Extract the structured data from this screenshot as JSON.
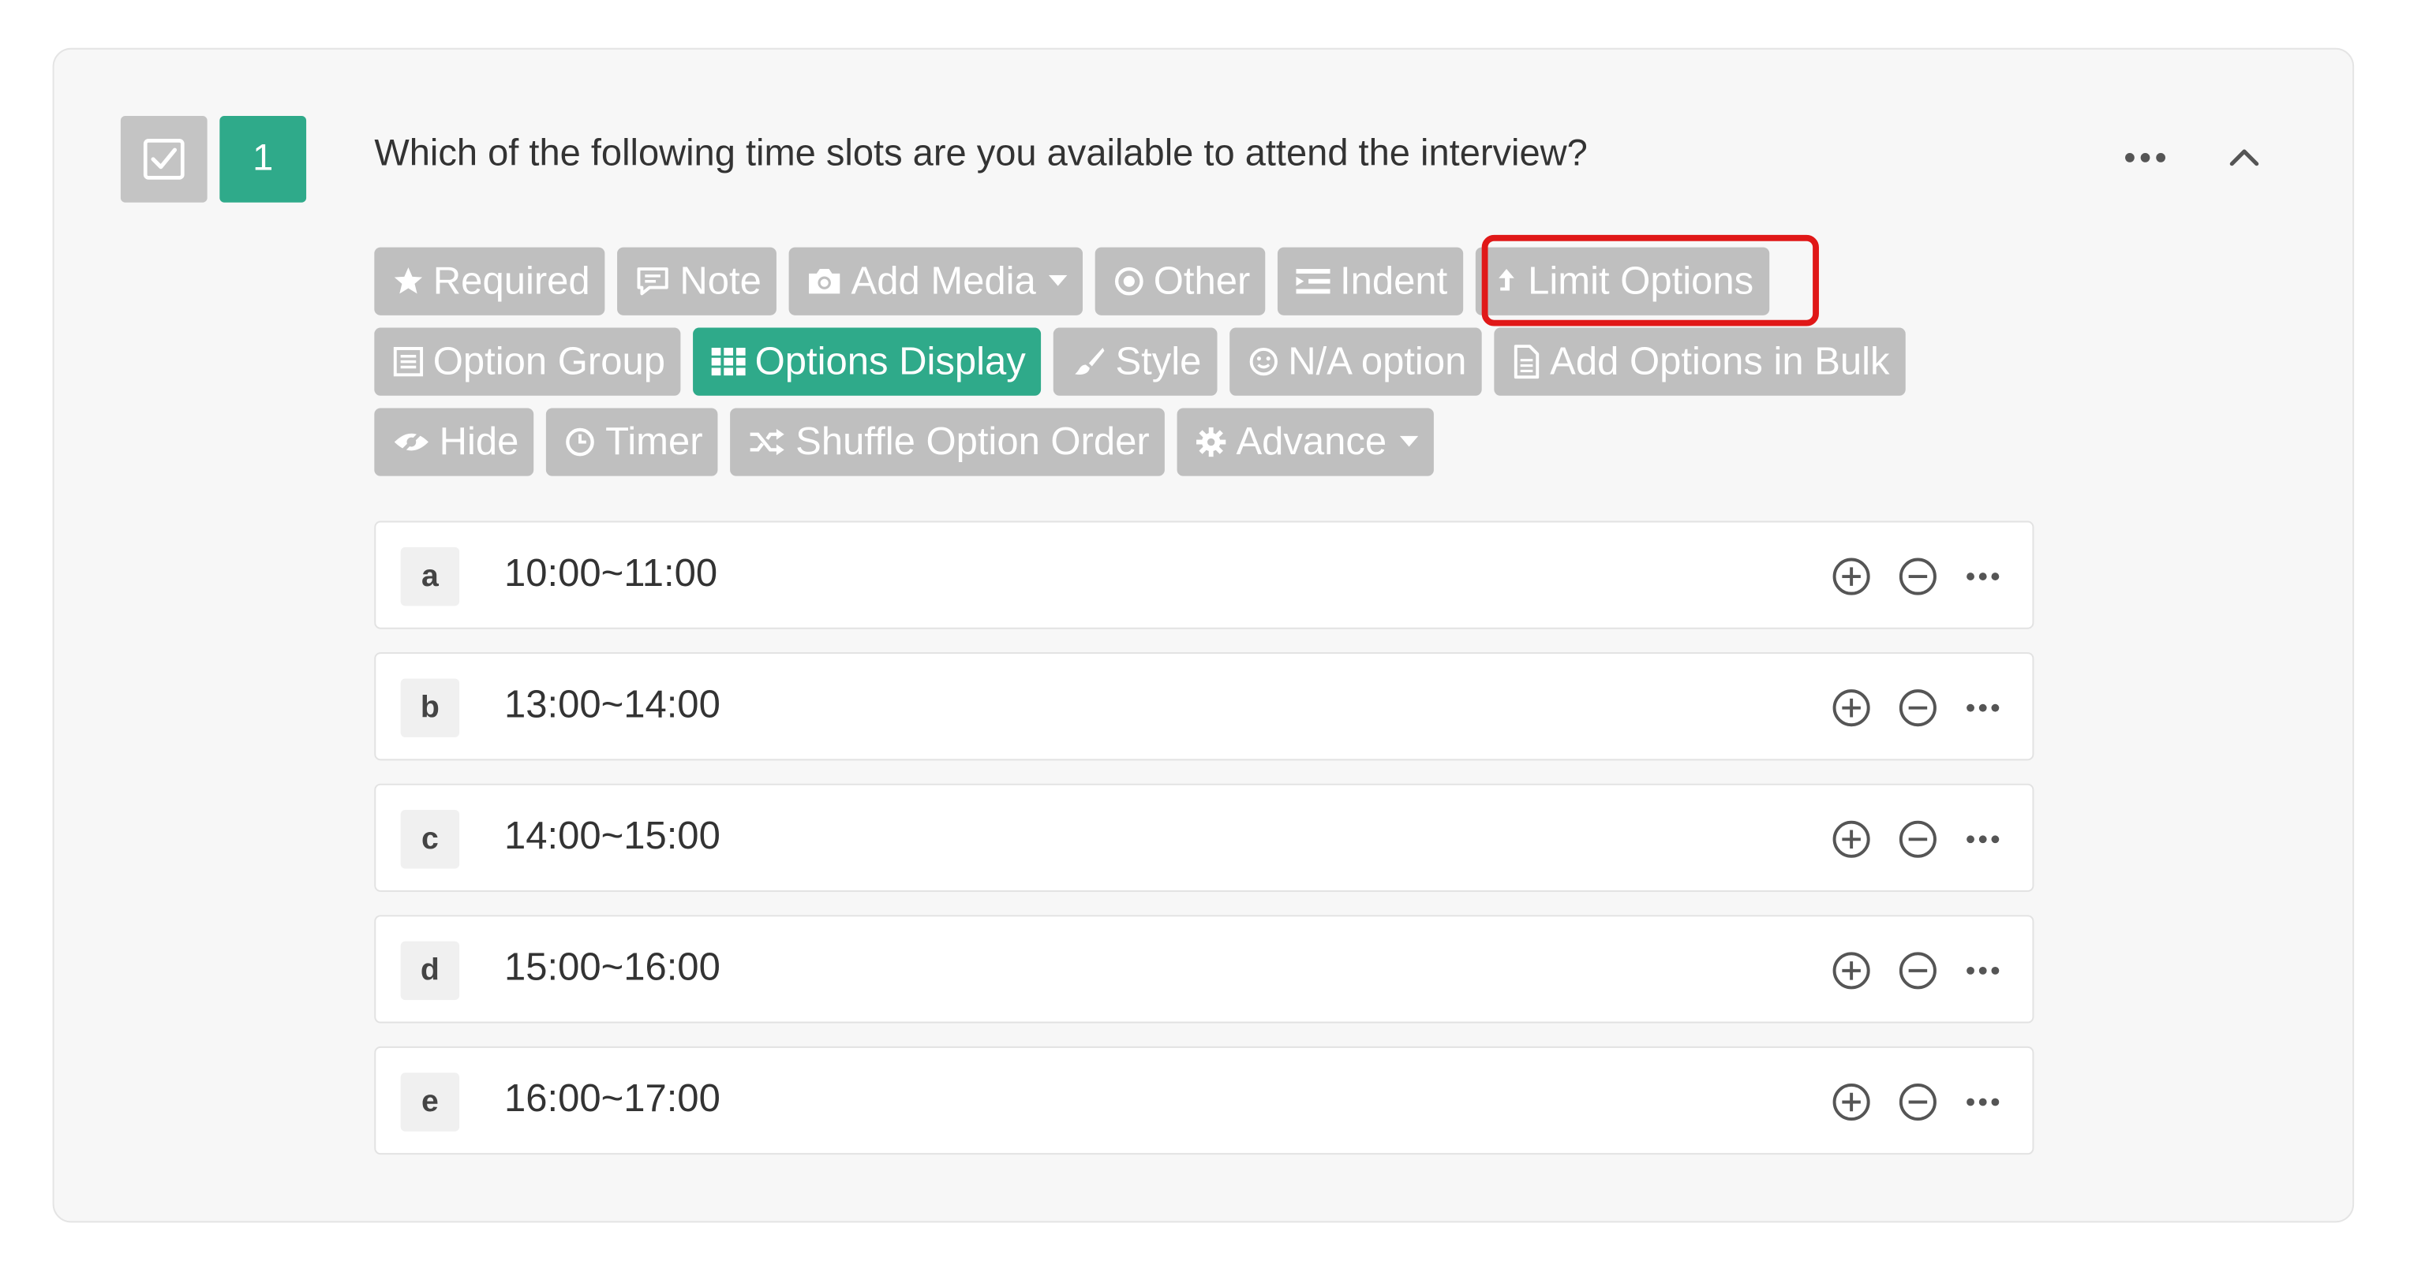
{
  "question": {
    "number": "1",
    "title": "Which of the following time slots are you available to attend the interview?"
  },
  "toolbar": {
    "row1": [
      {
        "label": "Required",
        "icon": "star-icon"
      },
      {
        "label": "Note",
        "icon": "comment-icon"
      },
      {
        "label": "Add Media",
        "icon": "camera-icon",
        "dropdown": true
      },
      {
        "label": "Other",
        "icon": "dot-circle-icon"
      },
      {
        "label": "Indent",
        "icon": "indent-icon"
      },
      {
        "label": "Limit Options",
        "icon": "arrow-up-icon",
        "highlighted": true
      }
    ],
    "row2": [
      {
        "label": "Option Group",
        "icon": "list-box-icon"
      },
      {
        "label": "Options Display",
        "icon": "grid-icon",
        "active": true
      },
      {
        "label": "Style",
        "icon": "brush-icon"
      },
      {
        "label": "N/A option",
        "icon": "smiley-icon"
      },
      {
        "label": "Add Options in Bulk",
        "icon": "document-icon"
      }
    ],
    "row3": [
      {
        "label": "Hide",
        "icon": "eye-slash-icon"
      },
      {
        "label": "Timer",
        "icon": "clock-icon"
      },
      {
        "label": "Shuffle Option Order",
        "icon": "shuffle-icon"
      },
      {
        "label": "Advance",
        "icon": "gear-icon",
        "dropdown": true
      }
    ]
  },
  "options": [
    {
      "letter": "a",
      "text": "10:00~11:00"
    },
    {
      "letter": "b",
      "text": "13:00~14:00"
    },
    {
      "letter": "c",
      "text": "14:00~15:00"
    },
    {
      "letter": "d",
      "text": "15:00~16:00"
    },
    {
      "letter": "e",
      "text": "16:00~17:00"
    }
  ],
  "colors": {
    "accent": "#2faa8a",
    "button_gray": "#bfbfbf",
    "highlight_border": "#e01818"
  }
}
